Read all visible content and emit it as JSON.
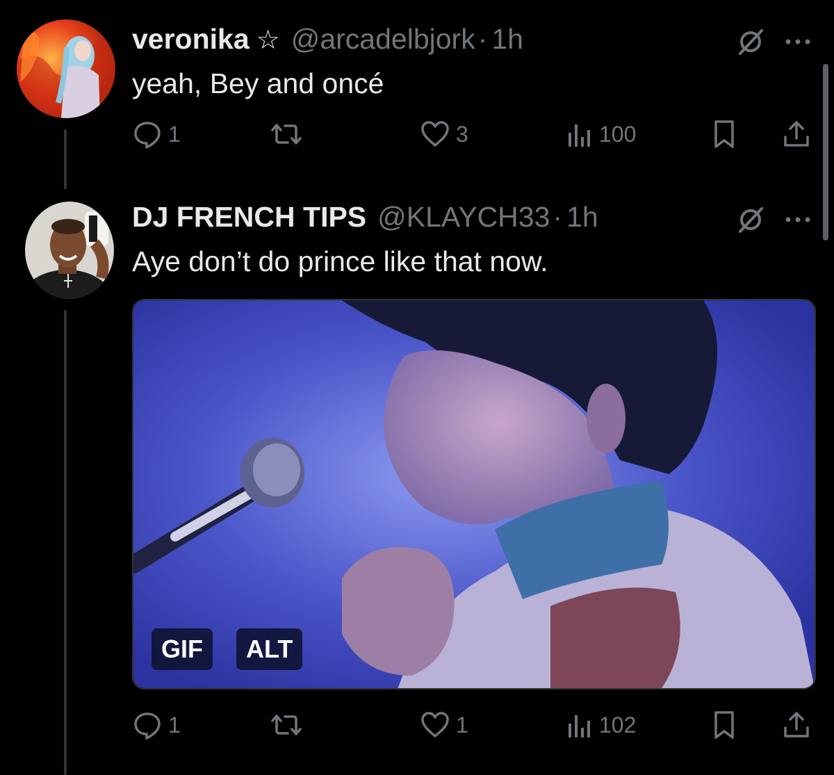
{
  "tweets": [
    {
      "display_name": "veronika",
      "name_badge_icon": "star-outline-icon",
      "handle": "@arcadelbjork",
      "separator": "·",
      "time": "1h",
      "text": "yeah, Bey and oncé",
      "replies": "1",
      "retweets": "",
      "likes": "3",
      "views": "100"
    },
    {
      "display_name": "DJ FRENCH TIPS",
      "handle": "@KLAYCH33",
      "separator": "·",
      "time": "1h",
      "text": "Aye don’t do prince like that now.",
      "media": {
        "type": "gif",
        "badges": [
          "GIF",
          "ALT"
        ]
      },
      "replies": "1",
      "retweets": "",
      "likes": "1",
      "views": "102"
    }
  ],
  "icons": {
    "top_right": [
      "grok-icon",
      "more-icon"
    ],
    "actions": [
      "reply-icon",
      "retweet-icon",
      "like-icon",
      "views-icon",
      "bookmark-icon",
      "share-icon"
    ]
  },
  "colors": {
    "background": "#000000",
    "primary_text": "#e7e9ea",
    "secondary_text": "#71767b",
    "thread_line": "#333639"
  }
}
